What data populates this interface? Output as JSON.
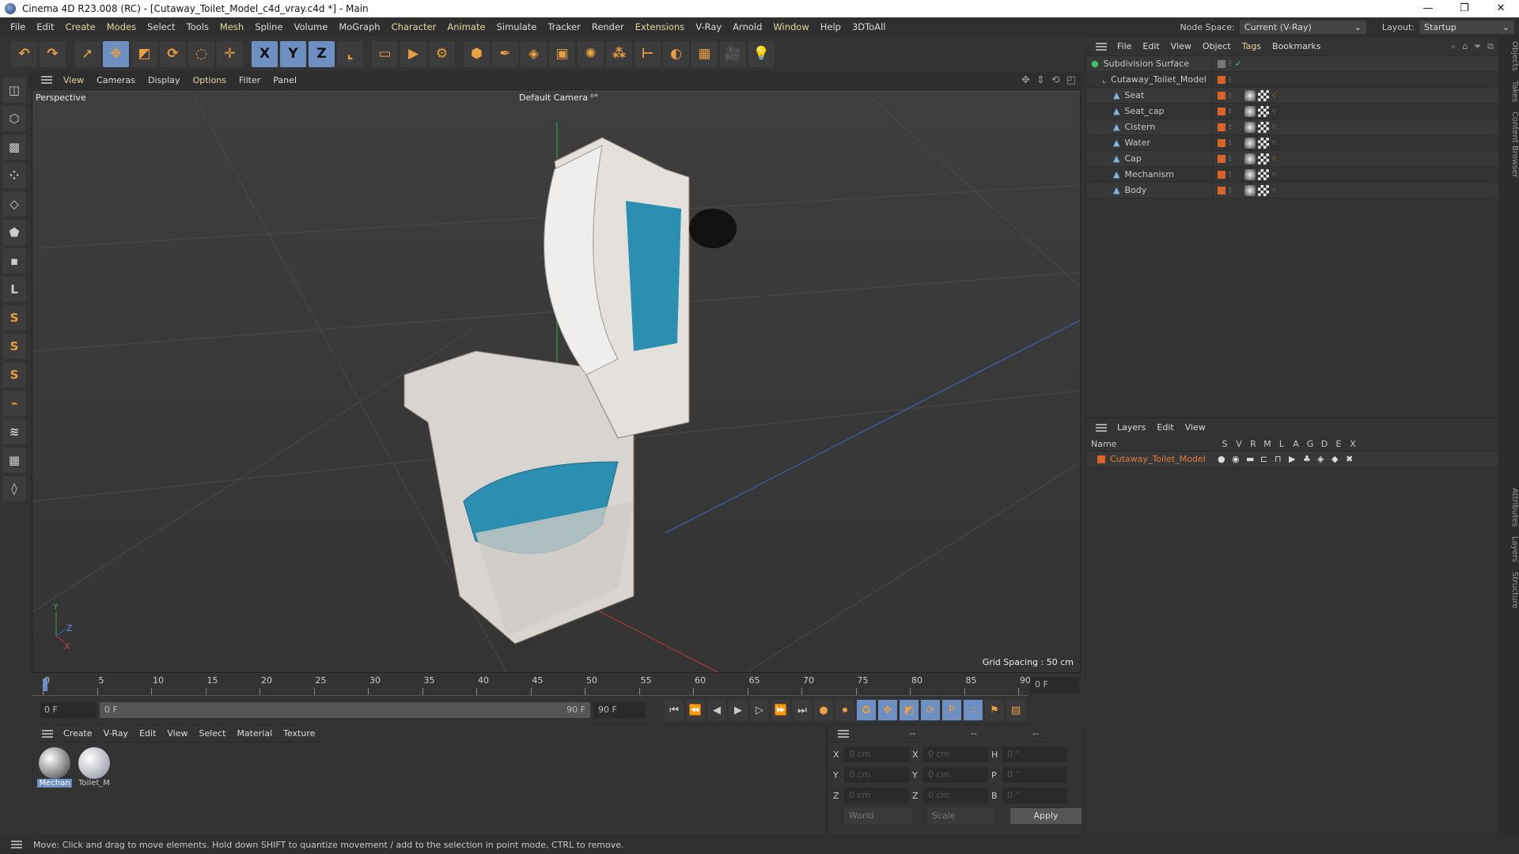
{
  "window": {
    "title": "Cinema 4D R23.008 (RC) - [Cutaway_Toilet_Model_c4d_vray.c4d *] - Main",
    "controls": [
      "—",
      "❐",
      "✕"
    ]
  },
  "menubar": {
    "items": [
      {
        "label": "File"
      },
      {
        "label": "Edit"
      },
      {
        "label": "Create",
        "hl": true
      },
      {
        "label": "Modes",
        "hl": true
      },
      {
        "label": "Select"
      },
      {
        "label": "Tools"
      },
      {
        "label": "Mesh",
        "hl": true
      },
      {
        "label": "Spline"
      },
      {
        "label": "Volume"
      },
      {
        "label": "MoGraph"
      },
      {
        "label": "Character",
        "hl": true
      },
      {
        "label": "Animate",
        "hl": true
      },
      {
        "label": "Simulate"
      },
      {
        "label": "Tracker"
      },
      {
        "label": "Render"
      },
      {
        "label": "Extensions",
        "hl": true
      },
      {
        "label": "V-Ray"
      },
      {
        "label": "Arnold"
      },
      {
        "label": "Window",
        "hl": true
      },
      {
        "label": "Help"
      },
      {
        "label": "3DToAll"
      }
    ],
    "node_space_label": "Node Space:",
    "node_space_value": "Current (V-Ray)",
    "layout_label": "Layout:",
    "layout_value": "Startup"
  },
  "toolbar": {
    "icons": [
      {
        "name": "undo-icon",
        "g": "↶"
      },
      {
        "name": "redo-icon",
        "g": "↷"
      },
      {
        "name": "select-icon",
        "g": "➚",
        "gap": true
      },
      {
        "name": "move-icon",
        "g": "✥",
        "sel": true
      },
      {
        "name": "scale-icon",
        "g": "◩"
      },
      {
        "name": "rotate-icon",
        "g": "⟳"
      },
      {
        "name": "psr-icon",
        "g": "◌"
      },
      {
        "name": "transform-icon",
        "g": "✛"
      },
      {
        "name": "x-axis-icon",
        "g": "X",
        "sel": true,
        "gap": true
      },
      {
        "name": "y-axis-icon",
        "g": "Y",
        "sel": true
      },
      {
        "name": "z-axis-icon",
        "g": "Z",
        "sel": true
      },
      {
        "name": "coordinate-system-icon",
        "g": "⌞"
      },
      {
        "name": "render-view-icon",
        "g": "▭",
        "gap": true
      },
      {
        "name": "render-picture-viewer-icon",
        "g": "▶"
      },
      {
        "name": "render-settings-icon",
        "g": "⚙"
      },
      {
        "name": "cube-icon",
        "g": "⬢",
        "gap": true
      },
      {
        "name": "pen-icon",
        "g": "✒"
      },
      {
        "name": "subdivision-icon",
        "g": "◈"
      },
      {
        "name": "extrude-icon",
        "g": "▣"
      },
      {
        "name": "cloner-icon",
        "g": "✺"
      },
      {
        "name": "mograph-icon",
        "g": "⁂"
      },
      {
        "name": "deformer-icon",
        "g": "⊢"
      },
      {
        "name": "field-icon",
        "g": "◐"
      },
      {
        "name": "floor-icon",
        "g": "▦"
      },
      {
        "name": "camera-icon",
        "g": "🎥"
      },
      {
        "name": "light-icon",
        "g": "💡"
      }
    ]
  },
  "left_toolbar": {
    "icons": [
      {
        "name": "make-editable-icon",
        "g": "◫"
      },
      {
        "name": "model-mode-icon",
        "g": "⬡"
      },
      {
        "name": "texture-mode-icon",
        "g": "▩"
      },
      {
        "name": "points-mode-icon",
        "g": "⁘"
      },
      {
        "name": "edges-mode-icon",
        "g": "◇"
      },
      {
        "name": "polygons-mode-icon",
        "g": "⬟"
      },
      {
        "name": "uv-mode-icon",
        "g": "▪"
      },
      {
        "name": "axis-mode-icon",
        "g": "L"
      },
      {
        "name": "snap-icon",
        "g": "S"
      },
      {
        "name": "snap-settings-icon",
        "g": "S"
      },
      {
        "name": "snap-grid-icon",
        "g": "S"
      },
      {
        "name": "magnet-icon",
        "g": "⌁"
      },
      {
        "name": "workplane-icon",
        "g": "≋"
      },
      {
        "name": "grid-icon",
        "g": "▦"
      },
      {
        "name": "paint-icon",
        "g": "◊"
      }
    ]
  },
  "viewport": {
    "menu": [
      {
        "label": "View",
        "hl": true
      },
      {
        "label": "Cameras"
      },
      {
        "label": "Display"
      },
      {
        "label": "Options",
        "hl": true
      },
      {
        "label": "Filter"
      },
      {
        "label": "Panel"
      }
    ],
    "name": "Perspective",
    "camera": "Default Camera ⁰°",
    "grid_spacing": "Grid Spacing : 50 cm",
    "axis": {
      "y": "Y",
      "z": "Z",
      "x": "X"
    }
  },
  "timeline": {
    "ticks": [
      "0",
      "5",
      "10",
      "15",
      "20",
      "25",
      "30",
      "35",
      "40",
      "45",
      "50",
      "55",
      "60",
      "65",
      "70",
      "75",
      "80",
      "85",
      "90"
    ],
    "current_frame_field": "0 F",
    "start": "0 F",
    "range_start": "0 F",
    "range_end": "90 F",
    "end": "90 F"
  },
  "transport": {
    "icons": [
      {
        "name": "go-to-start-icon",
        "g": "⏮"
      },
      {
        "name": "prev-key-icon",
        "g": "⏪"
      },
      {
        "name": "prev-frame-icon",
        "g": "◀"
      },
      {
        "name": "play-icon",
        "g": "▶"
      },
      {
        "name": "next-frame-icon",
        "g": "▷"
      },
      {
        "name": "next-key-icon",
        "g": "⏩"
      },
      {
        "name": "go-to-end-icon",
        "g": "⏭"
      },
      {
        "name": "record-icon",
        "g": "●"
      },
      {
        "name": "autokey-icon",
        "g": "⏺"
      },
      {
        "name": "keyframe-selection-icon",
        "g": "✪"
      },
      {
        "name": "key-position-icon",
        "g": "✥"
      },
      {
        "name": "key-scale-icon",
        "g": "◩"
      },
      {
        "name": "key-rotation-icon",
        "g": "⟳"
      },
      {
        "name": "key-param-icon",
        "g": "P"
      },
      {
        "name": "key-pla-icon",
        "g": "⁙"
      },
      {
        "name": "motion-icon",
        "g": "⚑"
      },
      {
        "name": "timeline-icon",
        "g": "▤"
      }
    ]
  },
  "material_manager": {
    "menu": [
      "Create",
      "V-Ray",
      "Edit",
      "View",
      "Select",
      "Material",
      "Texture"
    ],
    "materials": [
      {
        "label": "Mechan",
        "selected": true
      },
      {
        "label": "Toilet_M"
      }
    ]
  },
  "coordinates": {
    "headers": [
      "--",
      "--",
      "--"
    ],
    "rows": [
      {
        "a": "X",
        "av": "0 cm",
        "b": "X",
        "bv": "0 cm",
        "c": "H",
        "cv": "0 °"
      },
      {
        "a": "Y",
        "av": "0 cm",
        "b": "Y",
        "bv": "0 cm",
        "c": "P",
        "cv": "0 °"
      },
      {
        "a": "Z",
        "av": "0 cm",
        "b": "Z",
        "bv": "0 cm",
        "c": "B",
        "cv": "0 °"
      }
    ],
    "mode": "World",
    "size_mode": "Scale",
    "apply": "Apply"
  },
  "object_manager": {
    "menu": [
      {
        "label": "File"
      },
      {
        "label": "Edit"
      },
      {
        "label": "View"
      },
      {
        "label": "Object"
      },
      {
        "label": "Tags",
        "hl": true
      },
      {
        "label": "Bookmarks"
      }
    ],
    "objects": [
      {
        "name": "Subdivision Surface",
        "level": 0,
        "icon": "subdivision-icon"
      },
      {
        "name": "Cutaway_Toilet_Model",
        "level": 1,
        "icon": "null-icon"
      },
      {
        "name": "Seat",
        "level": 2
      },
      {
        "name": "Seat_cap",
        "level": 2
      },
      {
        "name": "Cistern",
        "level": 2
      },
      {
        "name": "Water",
        "level": 2
      },
      {
        "name": "Cap",
        "level": 2
      },
      {
        "name": "Mechanism",
        "level": 2
      },
      {
        "name": "Body",
        "level": 2
      }
    ]
  },
  "layers": {
    "menu": [
      "Layers",
      "Edit",
      "View"
    ],
    "columns": [
      "Name",
      "S",
      "V",
      "R",
      "M",
      "L",
      "A",
      "G",
      "D",
      "E",
      "X"
    ],
    "rows": [
      {
        "name": "Cutaway_Toilet_Model",
        "color": "#d9652b"
      }
    ]
  },
  "side_tabs": [
    "Objects",
    "Takes",
    "Content Browser",
    "Attributes",
    "Layers",
    "Structure"
  ],
  "status": "Move: Click and drag to move elements. Hold down SHIFT to quantize movement / add to the selection in point mode, CTRL to remove.",
  "colors": {
    "accent": "#6e8fc1",
    "object_orange": "#d9652b",
    "water": "#2a8fb0"
  }
}
